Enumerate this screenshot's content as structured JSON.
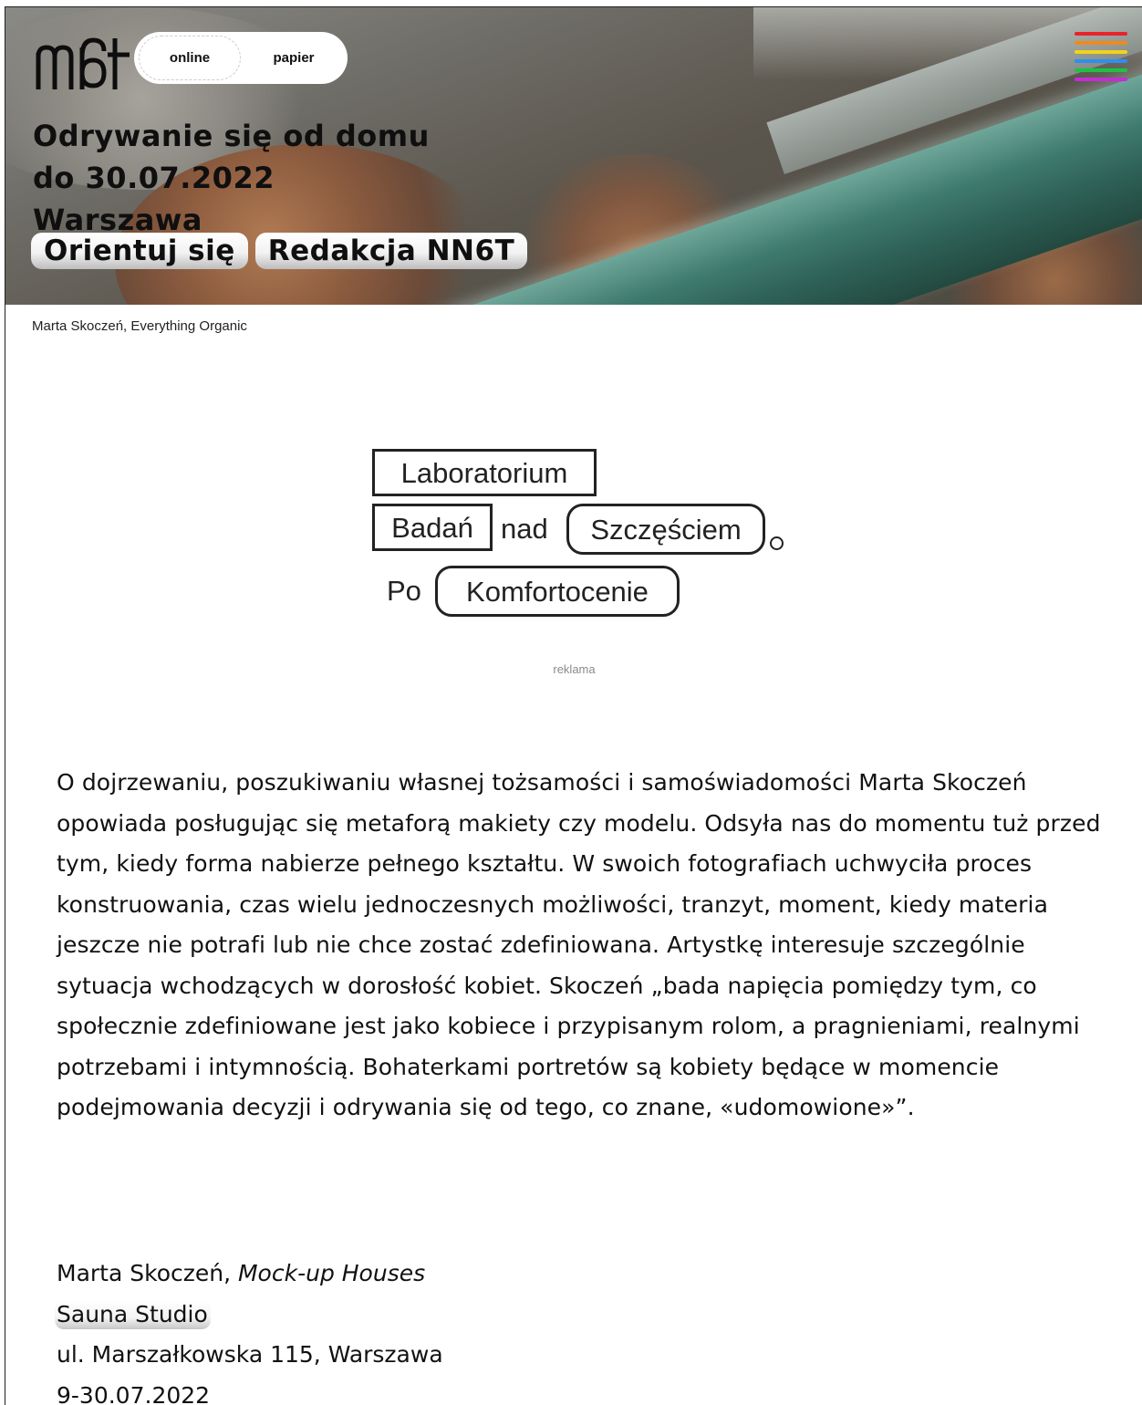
{
  "header": {
    "logo_name": "n6t-logo",
    "toggle": {
      "online_label": "online",
      "papier_label": "papier"
    },
    "menu_colors": [
      "#e8232a",
      "#f08a1c",
      "#f3d21c",
      "#2c8ff0",
      "#1ec243",
      "#c52bd6"
    ]
  },
  "hero": {
    "title": "Odrywanie się od domu",
    "date": "do 30.07.2022",
    "city": "Warszawa",
    "tags": [
      "Orientuj się",
      "Redakcja NN6T"
    ]
  },
  "image_caption": "Marta Skoczeń, Everything Organic",
  "ad": {
    "line1": "Laboratorium",
    "line2_box": "Badań",
    "line2_mid": "nad",
    "line2_round": "Szczęściem",
    "line3_plain": "Po",
    "line3_round": "Komfortocenie",
    "label": "reklama"
  },
  "article": {
    "body": "O dojrzewaniu, poszukiwaniu własnej tożsamości i samoświadomości Marta Skoczeń opowiada posługując się metaforą makiety czy modelu. Odsyła nas do momentu tuż przed tym, kiedy forma nabierze pełnego kształtu. W swoich fotografiach uchwyciła proces konstruowania, czas wielu jednoczesnych możliwości, tranzyt, moment, kiedy materia jeszcze nie potrafi lub nie chce zostać zdefiniowana. Artystkę interesuje szczególnie sytuacja wchodzących w dorosłość kobiet. Skoczeń „bada napięcia pomiędzy tym, co społecznie zdefiniowane jest jako kobiece i przypisanym rolom, a pragnieniami, realnymi potrzebami i intymnością. Bohaterkami portretów są kobiety będące w momencie podejmowania decyzji i odrywania się od tego, co znane, «udomowione»”.",
    "artist": "Marta Skoczeń, ",
    "work_title": "Mock-up Houses",
    "venue": "Sauna Studio",
    "address": "ul. Marszałkowska 115, Warszawa",
    "dates": "9-30.07.2022"
  }
}
